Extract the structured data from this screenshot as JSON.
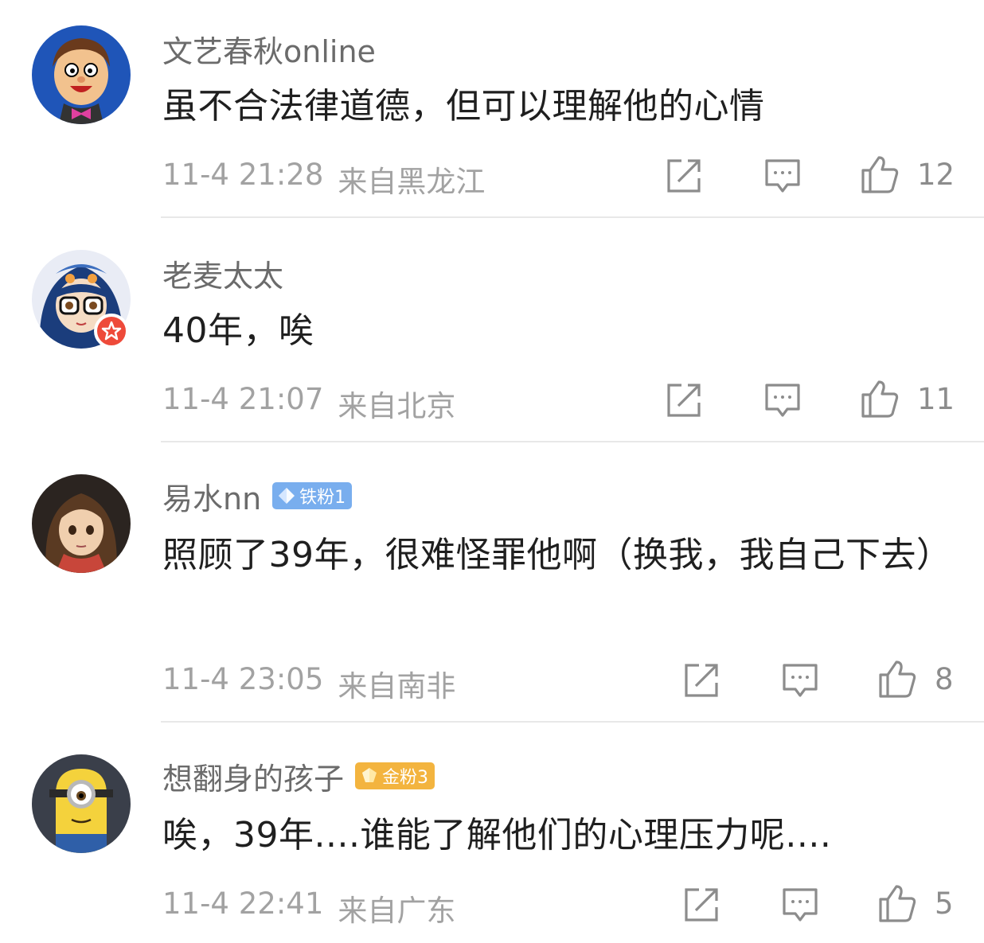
{
  "comments": [
    {
      "user": "文艺春秋online",
      "badge": null,
      "text": "虽不合法律道德，但可以理解他的心情",
      "time": "11-4 21:28",
      "location": "来自黑龙江",
      "likes": "12"
    },
    {
      "user": "老麦太太",
      "badge": null,
      "text": "40年，唉",
      "time": "11-4 21:07",
      "location": "来自北京",
      "likes": "11"
    },
    {
      "user": "易水nn",
      "badge": "铁粉1",
      "text": "照顾了39年，很难怪罪他啊（换我，我自己下去）",
      "time": "11-4 23:05",
      "location": "来自南非",
      "likes": "8"
    },
    {
      "user": "想翻身的孩子",
      "badge": "金粉3",
      "text": "唉，39年....谁能了解他们的心理压力呢....",
      "time": "11-4 22:41",
      "location": "来自广东",
      "likes": "5"
    }
  ],
  "icons": {
    "share": "share-icon",
    "reply": "comment-icon",
    "like": "thumbs-up-icon"
  },
  "colors": {
    "iron_fan_badge": "#79aeee",
    "gold_fan_badge": "#f3b43f",
    "verified": "#ee4a3a"
  }
}
